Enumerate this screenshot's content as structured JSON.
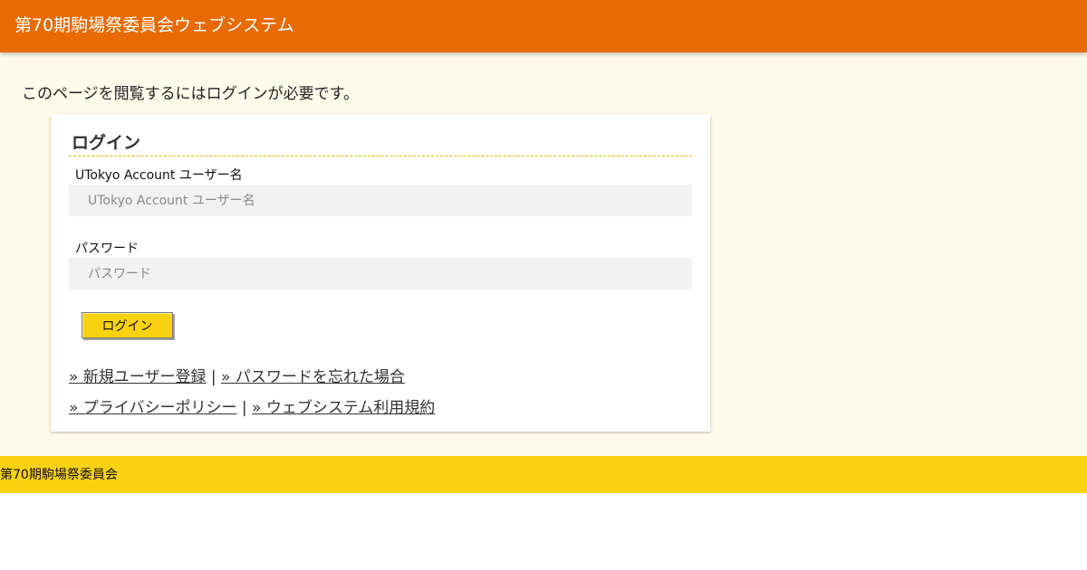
{
  "header": {
    "title": "第70期駒場祭委員会ウェブシステム"
  },
  "main": {
    "notice": "このページを閲覧するにはログインが必要です。",
    "login_card": {
      "title": "ログイン",
      "username": {
        "label": "UTokyo Account ユーザー名",
        "placeholder": "UTokyo Account ユーザー名",
        "value": ""
      },
      "password": {
        "label": "パスワード",
        "placeholder": "パスワード",
        "value": ""
      },
      "submit_label": "ログイン",
      "links_row1": {
        "signup": "» 新規ユーザー登録",
        "separator": "|",
        "forgot_password": "» パスワードを忘れた場合"
      },
      "links_row2": {
        "privacy_policy": "» プライバシーポリシー",
        "separator": "|",
        "terms": "» ウェブシステム利用規約"
      }
    }
  },
  "footer": {
    "text": "第70期駒場祭委員会"
  },
  "colors": {
    "header_bg": "#e86a00",
    "page_bg": "#fffbea",
    "accent_yellow": "#f9d10e",
    "input_bg": "#f2f2f2"
  }
}
